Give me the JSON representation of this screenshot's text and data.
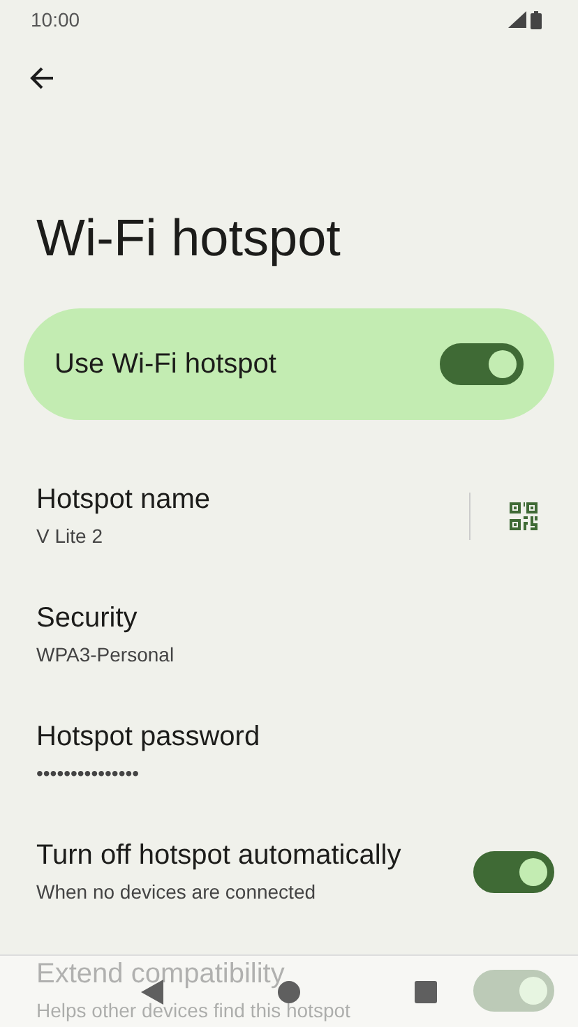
{
  "status_bar": {
    "time": "10:00"
  },
  "title": "Wi-Fi hotspot",
  "main_switch": {
    "label": "Use Wi-Fi hotspot",
    "on": true
  },
  "settings": [
    {
      "kind": "qr",
      "title": "Hotspot name",
      "summary": "V Lite 2"
    },
    {
      "kind": "text",
      "title": "Security",
      "summary": "WPA3-Personal"
    },
    {
      "kind": "text",
      "title": "Hotspot password",
      "summary": "•••••••••••••••"
    },
    {
      "kind": "switch",
      "title": "Turn off hotspot automatically",
      "summary": "When no devices are connected",
      "on": true
    },
    {
      "kind": "switch",
      "title": "Extend compatibility",
      "summary": "Helps other devices find this hotspot",
      "on": true,
      "faded": true
    }
  ]
}
